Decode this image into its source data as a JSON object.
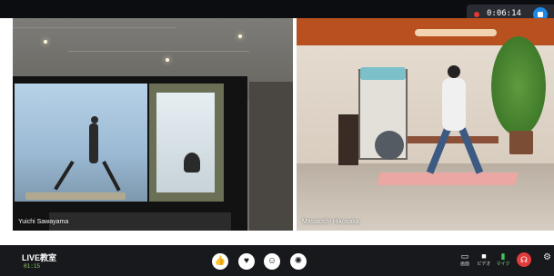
{
  "recording": {
    "elapsed": "0:06:14",
    "dot_color": "#e53935",
    "stop_color": "#1e88e5"
  },
  "video_tiles": [
    {
      "name": "Yuichi Sawayama"
    },
    {
      "name": "Masatoshi Hikosaka"
    }
  ],
  "session": {
    "title": "LIVE教室",
    "duration": "01:15"
  },
  "reactions": [
    {
      "icon": "thumbs-up-icon",
      "glyph": "👍"
    },
    {
      "icon": "heart-icon",
      "glyph": "♥"
    },
    {
      "icon": "smile-icon",
      "glyph": "☺"
    },
    {
      "icon": "party-popper-icon",
      "glyph": "✺"
    }
  ],
  "toolbar": {
    "screen_label": "画面",
    "video_label": "ビデオ",
    "mic_label": "マイク",
    "screen_icon": "monitor-icon",
    "video_icon": "camera-icon",
    "mic_icon": "microphone-icon",
    "leave_icon": "headset-icon",
    "settings_icon": "gear-icon"
  },
  "colors": {
    "bar_bg": "#18191c",
    "mic_active": "#43c456",
    "leave": "#e23b3b"
  }
}
